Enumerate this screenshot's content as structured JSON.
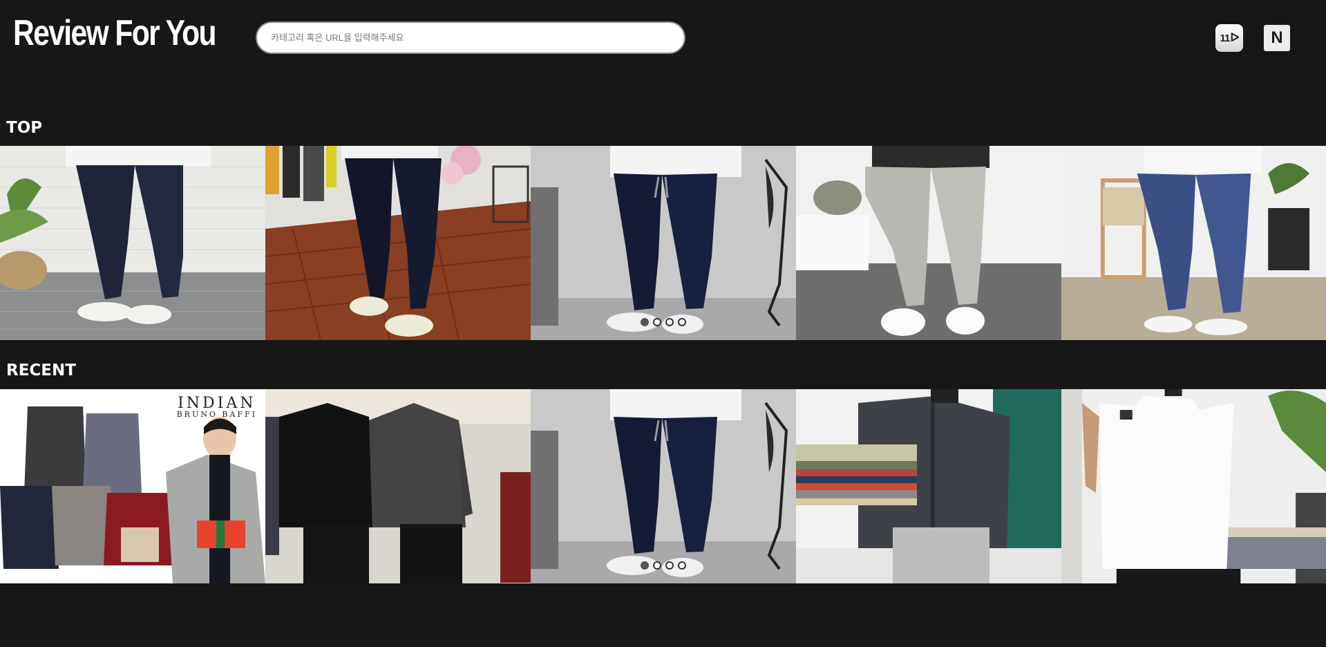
{
  "header": {
    "logo": "Review For You",
    "search_placeholder": "카테고리 혹은 URL을 입력해주세요",
    "shops": [
      {
        "name": "11st",
        "label": "11",
        "icon": "11st-logo-icon"
      },
      {
        "name": "naver",
        "label": "N",
        "icon": "naver-logo-icon"
      }
    ]
  },
  "sections": [
    {
      "title": "TOP",
      "items": [
        {
          "image": "navy chino pants with white sneakers on grey tile floor"
        },
        {
          "image": "navy slim pants on wooden herringbone floor"
        },
        {
          "image": "navy drawstring jogger pants with white slip-on shoes"
        },
        {
          "image": "light grey banding pants with white slip-on shoes"
        },
        {
          "image": "blue linen drawstring pants with white sneakers"
        }
      ]
    },
    {
      "title": "RECENT",
      "items": [
        {
          "image": "padded jackets collage with male model holding gift",
          "brand_line1": "INDIAN",
          "brand_line2": "BRUNO BAFFI"
        },
        {
          "image": "two men in black and grey long sleeve t-shirts"
        },
        {
          "image": "navy drawstring jogger pants with white slip-on shoes"
        },
        {
          "image": "man in charcoal short sleeve shirt holding stack of shirts"
        },
        {
          "image": "man in white sleeveless top taking mirror selfie"
        }
      ]
    }
  ],
  "carousel": {
    "slides": 4,
    "active_slide": 1
  },
  "colors": {
    "background": "#171717",
    "text": "#ffffff"
  }
}
